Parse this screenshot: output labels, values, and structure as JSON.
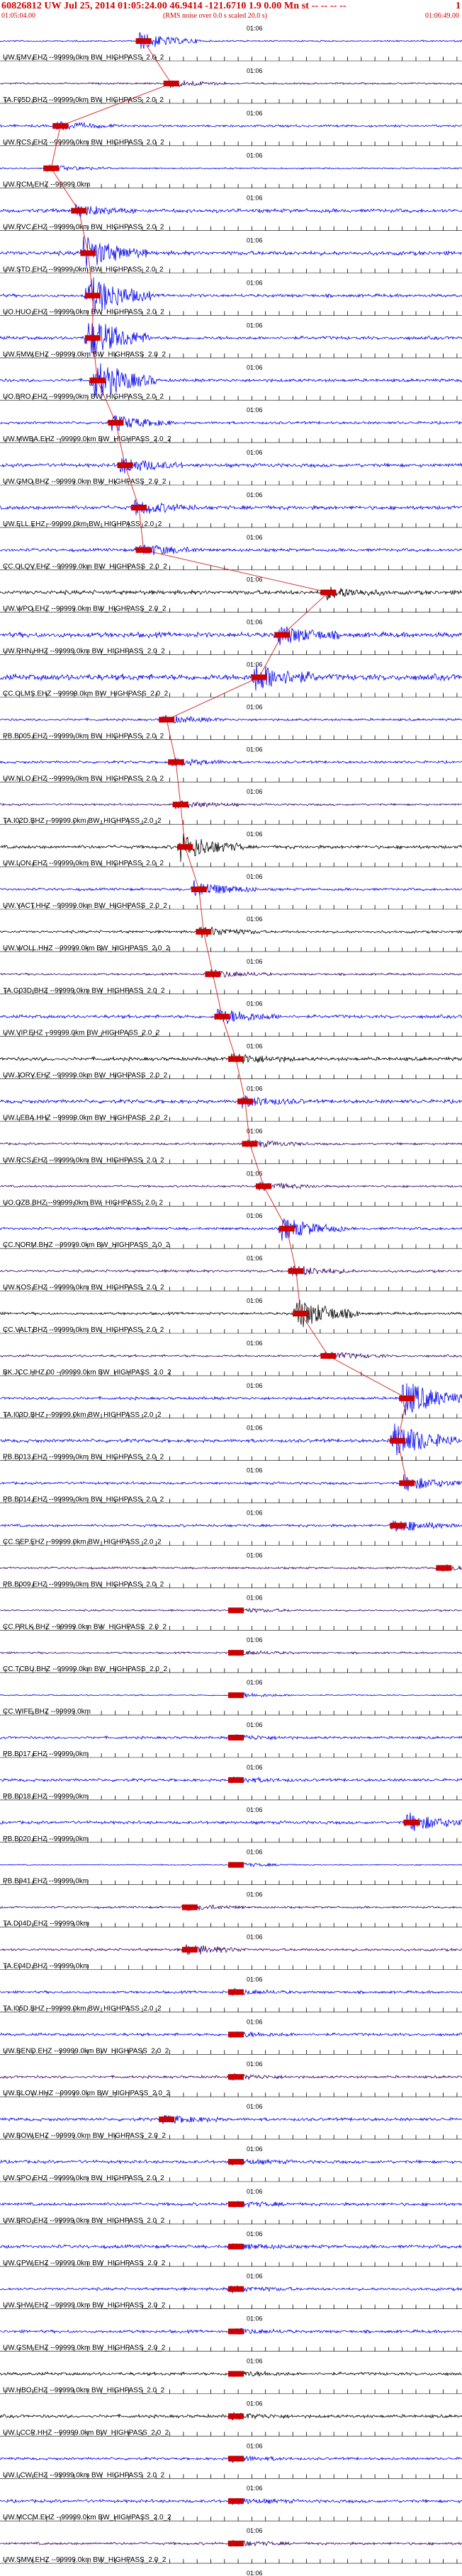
{
  "header": {
    "title": "60826812 UW Jul 25, 2014 01:05:24.00   46.9414 -121.6710   1.9 0.00 Mn st -- -- -- --",
    "title_suffix": "1",
    "start_time": "01:05:04.00",
    "note": "(RMS noise over 0.0 s scaled 20.0 s)",
    "end_time": "01:06:49.00"
  },
  "colors": {
    "blue_trace": "#0000ee",
    "black_trace": "#000000",
    "purple_trace": "#330066",
    "pick": "#cc0000",
    "tick": "#000000",
    "label_bg": "#ffffff"
  },
  "chart_data": {
    "type": "seismogram-record-section",
    "time_mark": "01:06",
    "stations": [
      {
        "label": "UW.EMV.EHZ --99999.0km BW_HIGHPASS_2.0_2",
        "color": "blue",
        "amp": 0.6,
        "burst": 0.3,
        "burstAmp": 3.2
      },
      {
        "label": "TA.F05D.BHZ --99999.0km BW_HIGHPASS_2.0_2",
        "color": "purple",
        "amp": 0.7,
        "burst": 0.36,
        "burstAmp": 1.5
      },
      {
        "label": "UW.RCS.EHZ --99999.0km BW_HIGHPASS_2.0_2",
        "color": "blue",
        "amp": 0.9,
        "burst": 0.12,
        "burstAmp": 1.6
      },
      {
        "label": "UW.RCM.EHZ --99999.0km",
        "color": "blue",
        "amp": 0.6,
        "burst": 0.1,
        "burstAmp": 1.2
      },
      {
        "label": "UW.RVC.EHZ --99999.0km BW_HIGHPASS_2.0_2",
        "color": "blue",
        "amp": 1.4,
        "burst": 0.16,
        "burstAmp": 2.0
      },
      {
        "label": "UW.STD.EHZ --99999.0km BW_HIGHPASS_2.0_2",
        "color": "blue",
        "amp": 1.6,
        "burst": 0.18,
        "burstAmp": 6.0
      },
      {
        "label": "UO.HUO.EHZ --99999.0km BW_HIGHPASS_2.0_2",
        "color": "blue",
        "amp": 1.2,
        "burst": 0.19,
        "burstAmp": 8.0
      },
      {
        "label": "UW.FMW.EHZ --99999.0km BW_HIGHPASS_2.0_2",
        "color": "blue",
        "amp": 1.3,
        "burst": 0.19,
        "burstAmp": 8.0
      },
      {
        "label": "UO.BRO.EHZ --99999.0km BW_HIGHPASS_2.0_2",
        "color": "blue",
        "amp": 1.2,
        "burst": 0.2,
        "burstAmp": 8.0
      },
      {
        "label": "UW.MWBA.EHZ --99999.0km BW_HIGHPASS_2.0_2",
        "color": "blue",
        "amp": 1.0,
        "burst": 0.24,
        "burstAmp": 3.0
      },
      {
        "label": "UW.GMO.BHZ --99999.0km BW_HIGHPASS_2.0_2",
        "color": "blue",
        "amp": 1.4,
        "burst": 0.26,
        "burstAmp": 3.0
      },
      {
        "label": "UW.ELL.EHZ --99999.0km BW_HIGHPASS_2.0_2",
        "color": "blue",
        "amp": 1.5,
        "burst": 0.29,
        "burstAmp": 2.5
      },
      {
        "label": "CC.OLQV.EHZ --99999.0km BW_HIGHPASS_2.0_2",
        "color": "blue",
        "amp": 1.2,
        "burst": 0.3,
        "burstAmp": 2.4
      },
      {
        "label": "UW.WPO.EHZ --99999.0km BW_HIGHPASS_2.0_2",
        "color": "black",
        "amp": 1.6,
        "burst": 0.7,
        "burstAmp": 2.2
      },
      {
        "label": "UW.RHN.HHZ --99999.0km BW_HIGHPASS_2.0_2",
        "color": "blue",
        "amp": 2.0,
        "burst": 0.6,
        "burstAmp": 3.5
      },
      {
        "label": "CC.OLMS.EHZ --99999.0km BW_HIGHPASS_2.0_2",
        "color": "blue",
        "amp": 2.4,
        "burst": 0.55,
        "burstAmp": 5.0
      },
      {
        "label": "PB.B005.EHZ --99999.0km BW_HIGHPASS_2.0_2",
        "color": "blue",
        "amp": 0.9,
        "burst": 0.35,
        "burstAmp": 1.5
      },
      {
        "label": "UW.NLO.EHZ --99999.0km BW_HIGHPASS_2.0_2",
        "color": "blue",
        "amp": 1.0,
        "burst": 0.37,
        "burstAmp": 1.5
      },
      {
        "label": "TA.I02D.BHZ --99999.0km BW_HIGHPASS_2.0_2",
        "color": "purple",
        "amp": 0.8,
        "burst": 0.38,
        "burstAmp": 1.5
      },
      {
        "label": "UW.LON.EHZ --99999.0km BW_HIGHPASS_2.0_2",
        "color": "black",
        "amp": 1.3,
        "burst": 0.39,
        "burstAmp": 5.0
      },
      {
        "label": "UW.YACT.HHZ --99999.0km BW_HIGHPASS_2.0_2",
        "color": "blue",
        "amp": 1.0,
        "burst": 0.42,
        "burstAmp": 3.0
      },
      {
        "label": "UW.WOLL.HHZ --99999.0km BW_HIGHPASS_2.0_2",
        "color": "black",
        "amp": 1.0,
        "burst": 0.43,
        "burstAmp": 2.0
      },
      {
        "label": "TA.G03D.BHZ --99999.0km BW_HIGHPASS_2.0_2",
        "color": "purple",
        "amp": 0.8,
        "burst": 0.45,
        "burstAmp": 1.6
      },
      {
        "label": "UW.VIP.EHZ --99999.0km BW_HIGHPASS_2.0_2",
        "color": "blue",
        "amp": 1.3,
        "burst": 0.47,
        "burstAmp": 3.0
      },
      {
        "label": "UW.JORV.EHZ --99999.0km BW_HIGHPASS_2.0_2",
        "color": "black",
        "amp": 1.4,
        "burst": 0.5,
        "burstAmp": 2.0
      },
      {
        "label": "UW.LEBA.HHZ --99999.0km BW_HIGHPASS_2.0_2",
        "color": "blue",
        "amp": 1.4,
        "burst": 0.52,
        "burstAmp": 2.0
      },
      {
        "label": "UW.RCS.EHZ --99999.0km BW_HIGHPASS_2.0_2",
        "color": "purple",
        "amp": 0.9,
        "burst": 0.53,
        "burstAmp": 1.5
      },
      {
        "label": "UO.OZB.BHZ --99999.0km BW_HIGHPASS_2.0_2",
        "color": "purple",
        "amp": 0.8,
        "burst": 0.56,
        "burstAmp": 1.5
      },
      {
        "label": "CC.NORM.BHZ --99999.0km BW_HIGHPASS_2.0_2",
        "color": "blue",
        "amp": 1.1,
        "burst": 0.61,
        "burstAmp": 4.0
      },
      {
        "label": "UW.KOS.EHZ --99999.0km BW_HIGHPASS_2.0_2",
        "color": "purple",
        "amp": 1.0,
        "burst": 0.63,
        "burstAmp": 2.0
      },
      {
        "label": "CC.VALT.BHZ --99999.0km BW_HIGHPASS_2.0_2",
        "color": "black",
        "amp": 1.0,
        "burst": 0.64,
        "burstAmp": 6.0
      },
      {
        "label": "BK.JCC.HHZ.00 --99999.0km BW_HIGHPASS_2.0_2",
        "color": "purple",
        "amp": 0.9,
        "burst": 0.7,
        "burstAmp": 1.5
      },
      {
        "label": "TA.I03D.BHZ --99999.0km BW_HIGHPASS_2.0_2",
        "color": "blue",
        "amp": 1.1,
        "burst": 0.87,
        "burstAmp": 7.0
      },
      {
        "label": "PB.B013.EHZ --99999.0km BW_HIGHPASS_2.0_2",
        "color": "blue",
        "amp": 1.3,
        "burst": 0.85,
        "burstAmp": 7.0
      },
      {
        "label": "PB.B014.EHZ --99999.0km BW_HIGHPASS_2.0_2",
        "color": "blue",
        "amp": 1.0,
        "burst": 0.87,
        "burstAmp": 3.0
      },
      {
        "label": "CC.SEP.EHZ --99999.0km BW_HIGHPASS_2.0_2",
        "color": "blue",
        "amp": 1.0,
        "burst": 0.85,
        "burstAmp": 2.5
      },
      {
        "label": "PB.B009.EHZ --99999.0km BW_HIGHPASS_2.0_2",
        "color": "purple",
        "amp": 0.8,
        "burst": 0.95,
        "burstAmp": 1.5
      },
      {
        "label": "CC.PRLK.BHZ --99999.0km BW_HIGHPASS_2.0_2",
        "color": "purple",
        "amp": 0.7,
        "burst": 0.5,
        "burstAmp": 1.0
      },
      {
        "label": "CC.TCBU.BHZ --99999.0km BW_HIGHPASS_2.0_2",
        "color": "purple",
        "amp": 0.7,
        "burst": 0.5,
        "burstAmp": 1.0
      },
      {
        "label": "CC.WIFE.BHZ --99999.0km",
        "color": "blue",
        "amp": 0.5,
        "burst": 0.5,
        "burstAmp": 1.0
      },
      {
        "label": "PB.B017.EHZ --99999.0km",
        "color": "blue",
        "amp": 1.0,
        "burst": 0.5,
        "burstAmp": 1.0
      },
      {
        "label": "PB.B018.EHZ --99999.0km",
        "color": "blue",
        "amp": 1.1,
        "burst": 0.5,
        "burstAmp": 1.0
      },
      {
        "label": "PB.B020.EHZ --99999.0km",
        "color": "blue",
        "amp": 1.2,
        "burst": 0.88,
        "burstAmp": 3.5
      },
      {
        "label": "PB.B941.EHZ --99999.0km",
        "color": "blue",
        "amp": 0.4,
        "burst": 0.5,
        "burstAmp": 1.0
      },
      {
        "label": "TA.D04D.EHZ --99999.0km",
        "color": "purple",
        "amp": 0.8,
        "burst": 0.4,
        "burstAmp": 1.2
      },
      {
        "label": "TA.E04D.BHZ --99999.0km",
        "color": "purple",
        "amp": 1.0,
        "burst": 0.4,
        "burstAmp": 2.0
      },
      {
        "label": "TA.I05D.BHZ --99999.0km BW_HIGHPASS_2.0_2",
        "color": "blue",
        "amp": 1.0,
        "burst": 0.5,
        "burstAmp": 1.0
      },
      {
        "label": "UW.BEND.EHZ --99999.0km BW_HIGHPASS_2.0_2",
        "color": "blue",
        "amp": 1.1,
        "burst": 0.5,
        "burstAmp": 1.0
      },
      {
        "label": "UW.BLOW.HHZ --99999.0km BW_HIGHPASS_2.0_2",
        "color": "purple",
        "amp": 1.0,
        "burst": 0.5,
        "burstAmp": 1.0
      },
      {
        "label": "UW.BOW.EHZ --99999.0km BW_HIGHPASS_2.0_2",
        "color": "blue",
        "amp": 1.2,
        "burst": 0.35,
        "burstAmp": 1.5
      },
      {
        "label": "UW.SPO.EHZ --99999.0km BW_HIGHPASS_2.0_2",
        "color": "blue",
        "amp": 1.2,
        "burst": 0.5,
        "burstAmp": 1.0
      },
      {
        "label": "UW.BRO.EHZ --99999.0km BW_HIGHPASS_2.0_2",
        "color": "blue",
        "amp": 1.2,
        "burst": 0.5,
        "burstAmp": 1.0
      },
      {
        "label": "UW.CPW.EHZ --99999.0km BW_HIGHPASS_2.0_2",
        "color": "blue",
        "amp": 1.3,
        "burst": 0.5,
        "burstAmp": 1.0
      },
      {
        "label": "UW.SHW.EHZ --99999.0km BW_HIGHPASS_2.0_2",
        "color": "blue",
        "amp": 1.1,
        "burst": 0.5,
        "burstAmp": 1.0
      },
      {
        "label": "UW.GSM.EHZ --99999.0km BW_HIGHPASS_2.0_2",
        "color": "blue",
        "amp": 1.1,
        "burst": 0.5,
        "burstAmp": 1.0
      },
      {
        "label": "UW.HBO.EHZ --99999.0km BW_HIGHPASS_2.0_2",
        "color": "black",
        "amp": 1.2,
        "burst": 0.5,
        "burstAmp": 1.0
      },
      {
        "label": "UW.LCCR.HHZ --99999.0km BW_HIGHPASS_2.0_2",
        "color": "black",
        "amp": 1.2,
        "burst": 0.5,
        "burstAmp": 1.0
      },
      {
        "label": "UW.LCW.EHZ --99999.0km BW_HIGHPASS_2.0_2",
        "color": "blue",
        "amp": 1.0,
        "burst": 0.5,
        "burstAmp": 1.0
      },
      {
        "label": "UW.MCCM.EHZ --99999.0km BW_HIGHPASS_2.0_2",
        "color": "blue",
        "amp": 1.2,
        "burst": 0.5,
        "burstAmp": 1.0
      },
      {
        "label": "UW.SMW.EHZ --99999.0km BW_HIGHPASS_2.0_2",
        "color": "purple",
        "amp": 1.0,
        "burst": 0.5,
        "burstAmp": 1.0
      },
      {
        "label": "UW.STOR.HHZ --99999.0km BW_HIGHPASS_2.0_2",
        "color": "black",
        "amp": 1.0,
        "burst": 0.5,
        "burstAmp": 1.0
      }
    ]
  }
}
